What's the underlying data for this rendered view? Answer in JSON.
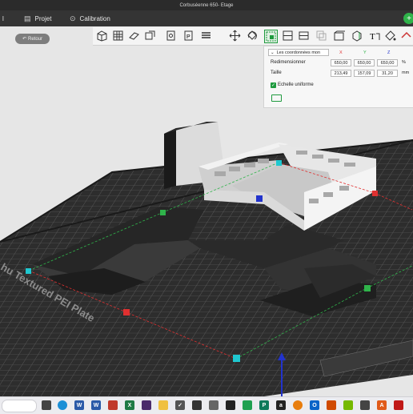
{
  "window": {
    "title": "Corbuséenne 650- Etage"
  },
  "menu": {
    "left_glyph": "l",
    "items": [
      {
        "label": "Projet"
      },
      {
        "label": "Calibration"
      }
    ]
  },
  "viewport": {
    "back_label": "Retour",
    "bed_label": "hu Textured PEI Plate"
  },
  "panel": {
    "coord_system": "Les coordonnées mon",
    "axes": [
      "X",
      "Y",
      "Z"
    ],
    "rows": [
      {
        "label": "Redimensionner",
        "values": [
          "650,00",
          "650,00",
          "650,00"
        ],
        "unit": "%"
      },
      {
        "label": "Taille",
        "values": [
          "213,49",
          "157,09",
          "31,20"
        ],
        "unit": "mm"
      }
    ],
    "uniform_label": "Echelle uniforme",
    "uniform_checked": true,
    "check_glyph": "✓"
  },
  "colors": {
    "accent": "#1f9a3e",
    "axis_x": "#e03030",
    "axis_y": "#2fb34a",
    "axis_z": "#2233cc",
    "handle": "#1fc8d0"
  },
  "taskbar_icons": [
    "file-explorer",
    "edge",
    "word",
    "app-red",
    "excel",
    "onenote",
    "xd",
    "folder",
    "check-app",
    "mail",
    "notes",
    "terminal",
    "photoshop",
    "camera",
    "chrome",
    "publisher",
    "amazon",
    "blender",
    "outlook",
    "office",
    "nvidia",
    "zbrush",
    "acrobat"
  ]
}
